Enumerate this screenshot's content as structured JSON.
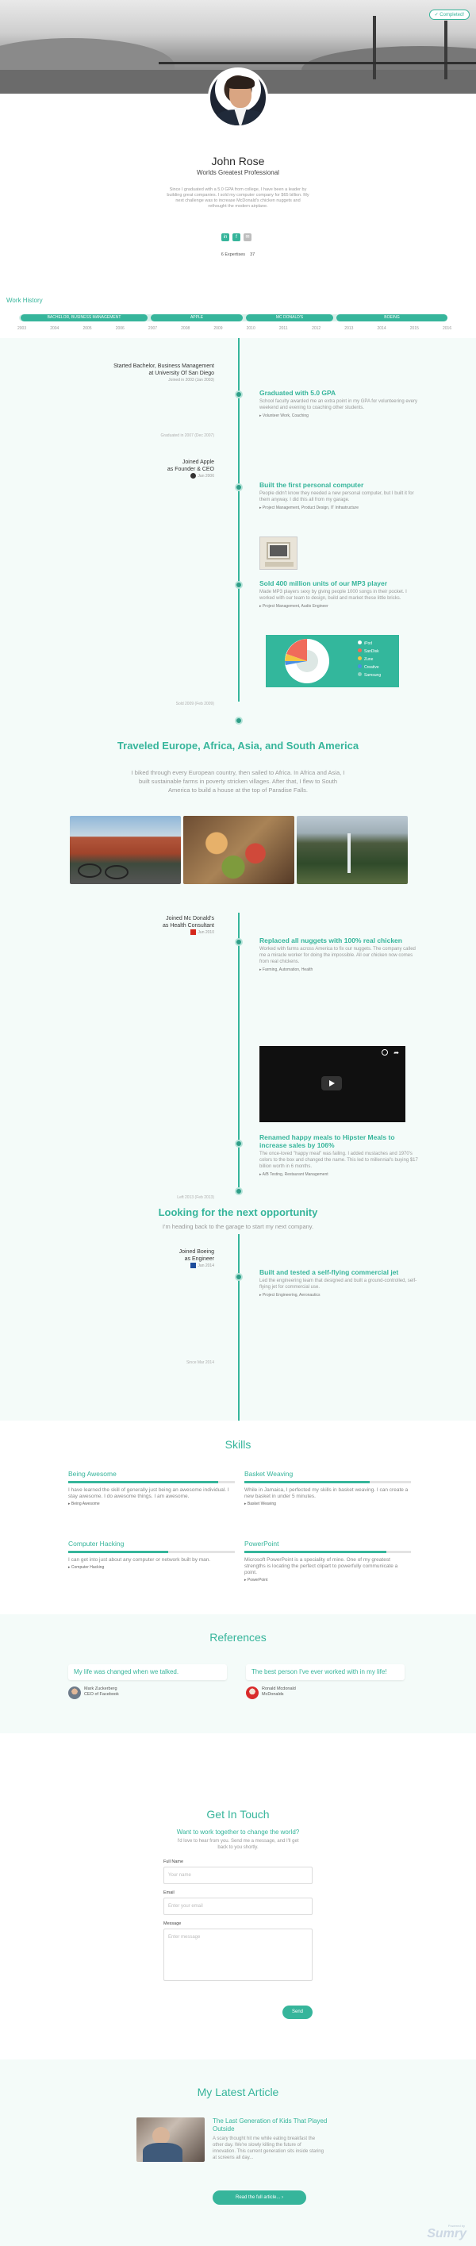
{
  "header": {
    "completed_label": "✓ Completed!",
    "name": "John Rose",
    "tagline": "Worlds Greatest Professional",
    "bio": "Since I graduated with a 5.0 GPA from college, I have been a leader by building great companies. I sold my computer company for $65 billion. My next challenge was to increase McDonald's chicken nuggets and rethought the modern airplane.",
    "social": [
      "in",
      "f",
      "✉"
    ],
    "stats": [
      "6 Expertises",
      "37"
    ]
  },
  "work_history": {
    "label": "Work History",
    "segments": [
      {
        "label": "BACHELOR, BUSINESS MANAGEMENT"
      },
      {
        "label": "APPLE"
      },
      {
        "label": "MC DONALD'S"
      },
      {
        "label": "BOEING"
      }
    ],
    "years": [
      "2003",
      "2004",
      "2005",
      "2006",
      "2007",
      "2008",
      "2009",
      "2010",
      "2011",
      "2012",
      "2013",
      "2014",
      "2015",
      "2016"
    ]
  },
  "timeline": {
    "education": {
      "line1": "Started Bachelor, Business Management",
      "line2": "at University Of San Diego",
      "dates": "Joined in 2003 (Jan 2003)",
      "end": "Graduated in 2007 (Dec 2007)"
    },
    "graduated": {
      "title": "Graduated with 5.0 GPA",
      "text": "School faculty awarded me an extra point in my GPA for volunteering every weekend and evening to coaching other students.",
      "tags": "Volunteer Work, Coaching"
    },
    "apple": {
      "line1": "Joined Apple",
      "line2": "as Founder & CEO",
      "dates": "Jan 2006"
    },
    "computer": {
      "title": "Built the first personal computer",
      "text": "People didn't know they needed a new personal computer, but I built it for them anyway. I did this all from my garage.",
      "tags": "Project Management, Product Design, IT Infrastructure"
    },
    "mp3": {
      "title": "Sold 400 million units of our MP3 player",
      "text": "Made MP3 players sexy by giving people 1000 songs in their pocket. I worked with our team to design, build and market these little bricks.",
      "tags": "Project Management, Audio Engineer",
      "legend": [
        "iPod",
        "SanDisk",
        "Zune",
        "Creative",
        "Samsung"
      ],
      "end": "Sold 2009 (Feb 2009)"
    },
    "travel": {
      "title": "Traveled Europe, Africa, Asia, and South America",
      "text": "I biked through every European country, then sailed to Africa. In Africa and Asia, I built sustainable farms in poverty stricken villages. After that, I flew to South America to build a house at the top of Paradise Falls."
    },
    "mcd": {
      "line1": "Joined Mc Donald's",
      "line2": "as Health Consultant",
      "dates": "Jun 2010"
    },
    "nuggets": {
      "title": "Replaced all nuggets with 100% real chicken",
      "text": "Worked with farms across America to fix our nuggets. The company called me a miracle worker for doing the impossible. All our chicken now comes from real chickens.",
      "tags": "Farming, Automation, Health"
    },
    "meals": {
      "title": "Renamed happy meals to Hipster Meals to increase sales by 106%",
      "text": "The once-loved \"happy meal\" was failing. I added mustaches and 1970's colors to the box and changed the name. This led to millennial's buying $17 billion worth in 6 months.",
      "tags": "A/B Testing, Restaurant Management",
      "end": "Left 2013 (Feb 2013)"
    },
    "next": {
      "title": "Looking for the next opportunity",
      "text": "I'm heading back to the garage to start my next company."
    },
    "boeing": {
      "line1": "Joined Boeing",
      "line2": "as Engineer",
      "dates": "Jan 2014"
    },
    "jet": {
      "title": "Built and tested a self-flying commercial jet",
      "text": "Led the engineering team that designed and built a ground-controlled, self-flying jet for commercial use.",
      "tags": "Project Engineering, Aeronautics",
      "end": "Since Mar 2014"
    }
  },
  "skills": {
    "title": "Skills",
    "items": [
      {
        "name": "Being Awesome",
        "level": 0.9,
        "text": "I have learned the skill of generally just being an awesome individual. I stay awesome. I do awesome things. I am awesome.",
        "tag": "Being Awesome"
      },
      {
        "name": "Basket Weaving",
        "level": 0.75,
        "text": "While in Jamaica, I perfected my skills in basket weaving. I can create a new basket in under 5 minutes.",
        "tag": "Basket Weaving"
      },
      {
        "name": "Computer Hacking",
        "level": 0.6,
        "text": "I can get into just about any computer or network built by man.",
        "tag": "Computer Hacking"
      },
      {
        "name": "PowerPoint",
        "level": 0.85,
        "text": "Microsoft PowerPoint is a speciality of mine. One of my greatest strengths is locating the perfect clipart to powerfully communicate a point.",
        "tag": "PowerPoint"
      }
    ]
  },
  "references": {
    "title": "References",
    "items": [
      {
        "quote": "My life was changed when we talked.",
        "name": "Mark Zuckerberg",
        "role": "CEO of Facebook"
      },
      {
        "quote": "The best person I've ever worked with in my life!",
        "name": "Ronald Mcdonald",
        "role": "McDonalds"
      }
    ]
  },
  "contact": {
    "title": "Get In Touch",
    "subtitle": "Want to work together to change the world?",
    "text": "I'd love to hear from you. Send me a message, and I'll get back to you shortly.",
    "full_name_label": "Full Name",
    "full_name_placeholder": "Your name",
    "email_label": "Email",
    "email_placeholder": "Enter your email",
    "message_label": "Message",
    "message_placeholder": "Enter message",
    "send_label": "Send"
  },
  "article": {
    "title": "My Latest Article",
    "headline": "The Last Generation of Kids That Played Outside",
    "excerpt": "A scary thought hit me while eating breakfast the other day. We're slowly killing the future of innovation. This current generation sits inside staring at screens all day...",
    "button": "Read the full article... ›"
  },
  "footer": {
    "brand": "Sumry",
    "brand_sub": "Powered by"
  },
  "colors": {
    "accent": "#36b59b",
    "band": "#f4fbf9"
  }
}
